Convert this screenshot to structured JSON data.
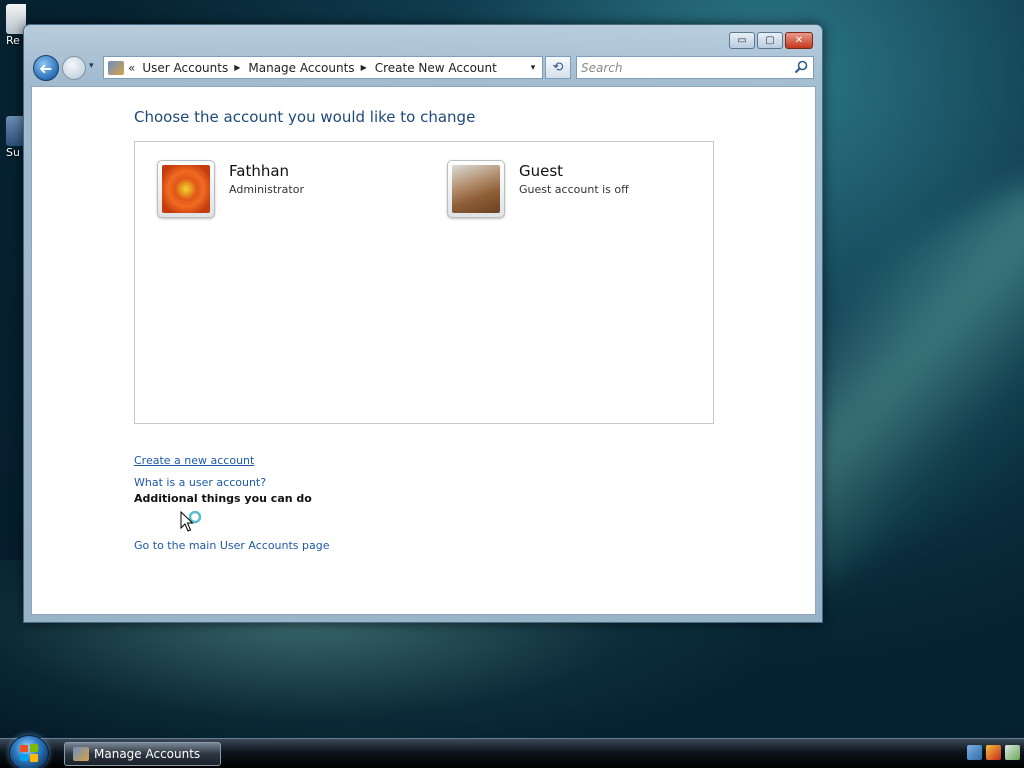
{
  "desktop": {
    "icons": [
      {
        "label": "Re",
        "name": "recycle-bin"
      },
      {
        "label": "Su",
        "name": "support"
      }
    ]
  },
  "window": {
    "controls": {
      "minimize": "▭",
      "maximize": "▢",
      "close": "✕"
    },
    "nav": {
      "back_icon": "➜",
      "dropdown_icon": "▾"
    },
    "address": {
      "chevron": "«",
      "crumbs": [
        "User Accounts",
        "Manage Accounts",
        "Create New Account"
      ],
      "separator": "▶",
      "dropdown_icon": "▾"
    },
    "refresh_icon": "⟲",
    "search": {
      "placeholder": "Search"
    }
  },
  "main": {
    "title": "Choose the account you would like to change",
    "accounts": [
      {
        "name": "Fathhan",
        "desc": "Administrator",
        "picture": "orange-flower-picture"
      },
      {
        "name": "Guest",
        "desc": "Guest account is off",
        "picture": "briefcase-picture"
      }
    ],
    "links": {
      "create_account": "Create a new account",
      "what_is_account": "What is a user account?"
    },
    "additional_heading": "Additional things you can do",
    "additional_link": "Go to the main User Accounts page"
  },
  "taskbar": {
    "task_label": "Manage Accounts",
    "tray_icons": [
      "network-icon",
      "security-shield-icon",
      "volume-icon"
    ]
  },
  "colors": {
    "title_blue": "#1e4a78",
    "link_blue": "#1e5aa8"
  }
}
